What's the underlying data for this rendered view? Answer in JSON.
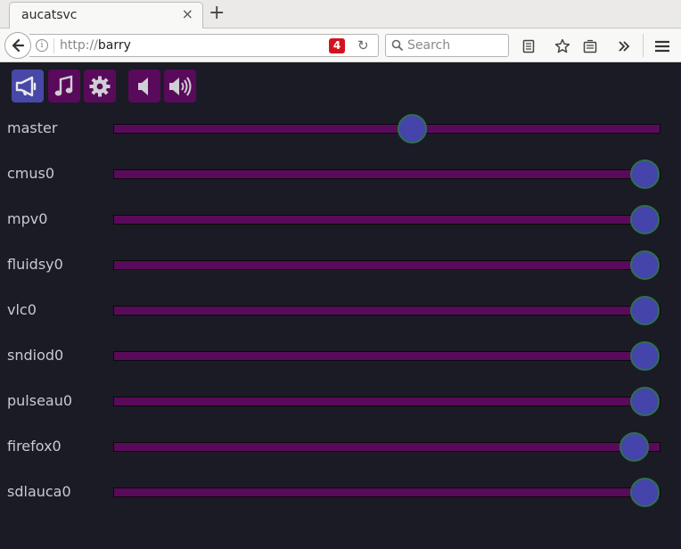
{
  "browser": {
    "tab_title": "aucatsvc",
    "tab_close": "×",
    "new_tab": "+",
    "url_scheme": "http://",
    "url_host": "barry",
    "url_badge": "4",
    "search_placeholder": "Search"
  },
  "toolbar": {
    "buttons": [
      {
        "name": "announce",
        "icon": "megaphone-icon",
        "active": true
      },
      {
        "name": "music",
        "icon": "music-note-icon",
        "active": false
      },
      {
        "name": "settings",
        "icon": "gear-icon",
        "active": false
      },
      {
        "name": "volume-down",
        "icon": "speaker-low-icon",
        "active": false
      },
      {
        "name": "volume-up",
        "icon": "speaker-high-icon",
        "active": false
      }
    ]
  },
  "channels": [
    {
      "label": "master",
      "level": 0.55
    },
    {
      "label": "cmus0",
      "level": 1.0
    },
    {
      "label": "mpv0",
      "level": 1.0
    },
    {
      "label": "fluidsy0",
      "level": 1.0
    },
    {
      "label": "vlc0",
      "level": 1.0
    },
    {
      "label": "sndiod0",
      "level": 1.0
    },
    {
      "label": "pulseau0",
      "level": 1.0
    },
    {
      "label": "firefox0",
      "level": 0.98
    },
    {
      "label": "sdlauca0",
      "level": 1.0
    }
  ],
  "colors": {
    "background": "#1b1b26",
    "track": "#5a0a5a",
    "knob": "#4444aa",
    "button_active": "#4848a8",
    "button_normal": "#5a0a5a",
    "label": "#c9c9d0"
  }
}
